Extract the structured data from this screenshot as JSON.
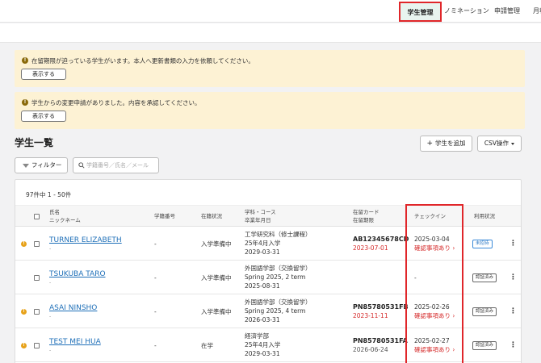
{
  "topnav": {
    "items": [
      {
        "label": "学生管理",
        "active": true
      },
      {
        "label": "ノミネーション"
      },
      {
        "label": "申請管理"
      },
      {
        "label": "月報"
      }
    ]
  },
  "alerts": [
    {
      "icon": "info-icon",
      "message": "在留期限が迫っている学生がいます。本人へ更新書類の入力を依頼してください。",
      "button": "表示する"
    },
    {
      "icon": "info-icon",
      "message": "学生からの変更申請がありました。内容を承認してください。",
      "button": "表示する"
    }
  ],
  "page": {
    "title": "学生一覧",
    "add_button": "学生を追加",
    "csv_button": "CSV操作",
    "filter_button": "フィルター",
    "search_placeholder": "学籍番号／氏名／メール"
  },
  "table": {
    "count_text": "97件中 1 - 50件",
    "headers": {
      "name_1": "氏名",
      "name_2": "ニックネーム",
      "student_no": "学籍番号",
      "enrollment": "在籍状況",
      "course_1": "学科・コース",
      "course_2": "卒業年月日",
      "card_1": "在留カード",
      "card_2": "在留期限",
      "checkin": "チェックイン",
      "usage": "利用状況"
    },
    "rows": [
      {
        "warn": true,
        "name": "TURNER ELIZABETH",
        "nickname": "-",
        "student_no": "-",
        "enrollment": "入学準備中",
        "course": "工学研究科（修士課程）",
        "intake": "25年4月入学",
        "grad": "2029-03-31",
        "card_no": "AB12345678CD",
        "card_exp": "2023-07-01",
        "card_exp_red": true,
        "checkin_date": "2025-03-04",
        "checkin_link": "確認事項あり ›",
        "badge": "未招待",
        "badge_style": "blue"
      },
      {
        "warn": false,
        "name": "TSUKUBA TARO",
        "nickname": "-",
        "student_no": "-",
        "enrollment": "入学準備中",
        "course": "外国語学部（交換留学）",
        "intake": "Spring 2025, 2 term",
        "grad": "2025-08-31",
        "card_no": "",
        "card_exp": "",
        "card_exp_red": false,
        "checkin_date": "-",
        "checkin_link": "",
        "badge": "認証済み",
        "badge_style": "gray"
      },
      {
        "warn": true,
        "name": "ASAI NINSHO",
        "nickname": "-",
        "student_no": "-",
        "enrollment": "入学準備中",
        "course": "外国語学部（交換留学）",
        "intake": "Spring 2025, 4 term",
        "grad": "2026-03-31",
        "card_no": "PN85780531FB",
        "card_exp": "2023-11-11",
        "card_exp_red": true,
        "checkin_date": "2025-02-26",
        "checkin_link": "確認事項あり ›",
        "badge": "認証済み",
        "badge_style": "gray"
      },
      {
        "warn": true,
        "name": "TEST MEI HUA",
        "nickname": "-",
        "student_no": "-",
        "enrollment": "在学",
        "course": "経済学部",
        "intake": "25年4月入学",
        "grad": "2029-03-31",
        "card_no": "PN85780531FA",
        "card_exp": "2026-06-24",
        "card_exp_red": false,
        "checkin_date": "2025-02-27",
        "checkin_link": "確認事項あり ›",
        "badge": "認証済み",
        "badge_style": "gray"
      }
    ]
  },
  "colors": {
    "accent_red": "#e0262a",
    "link_blue": "#1e6fb8",
    "alert_bg": "#fdf2d4",
    "warn_orange": "#e7a21a"
  }
}
